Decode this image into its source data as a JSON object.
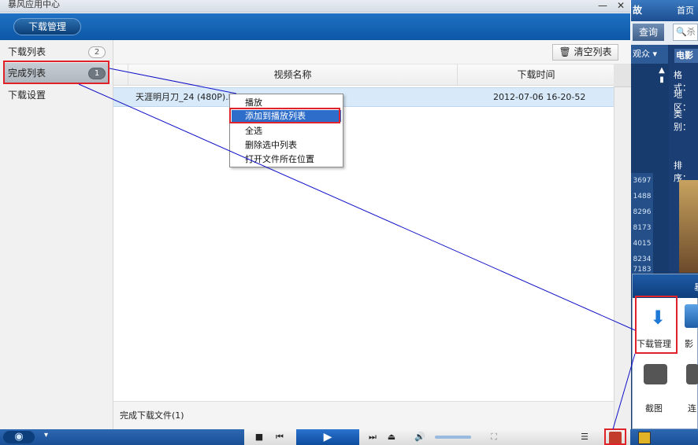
{
  "window": {
    "title": "暴风应用中心",
    "minimize_label": "—",
    "close_label": "✕"
  },
  "tabbar": {
    "active_tab": "下载管理"
  },
  "sidebar": {
    "items": [
      {
        "label": "下载列表",
        "badge": "2"
      },
      {
        "label": "完成列表",
        "badge": "1"
      },
      {
        "label": "下载设置"
      }
    ]
  },
  "toolbar": {
    "clear_label": "清空列表",
    "clear_icon": "trash-icon"
  },
  "table": {
    "columns": [
      "视频名称",
      "下载时间"
    ],
    "rows": [
      {
        "name": "天涯明月刀_24 (480P).b",
        "time": "2012-07-06 16-20-52"
      }
    ]
  },
  "context_menu": {
    "items": [
      "播放",
      "添加到播放列表",
      "全选",
      "删除选中列表",
      "打开文件所在位置"
    ],
    "highlighted": "添加到播放列表"
  },
  "footer": {
    "status": "完成下载文件(1)"
  },
  "right_panel": {
    "header_partial": "故",
    "nav_home": "首页",
    "query_btn": "查询",
    "search_placeholder": "杀",
    "watch_label": "观众",
    "category_tab": "电影",
    "filters": [
      "格式：",
      "地区：",
      "类别："
    ],
    "sort_label": "排序：",
    "numbers": [
      "3697",
      "1488",
      "8296",
      "8173",
      "4015",
      "8234",
      "7183"
    ],
    "popup": {
      "title_partial": "暴",
      "apps": [
        {
          "label": "下载管理",
          "icon": "download-icon"
        },
        {
          "label": "影",
          "icon": "film-icon"
        },
        {
          "label": "截图",
          "icon": "camera-icon"
        },
        {
          "label": "连",
          "icon": "video-icon"
        }
      ]
    }
  },
  "colors": {
    "accent": "#1f71c3",
    "highlight": "#2e6dc9",
    "annotation_red": "#e0232b",
    "annotation_line": "#1010c8"
  }
}
